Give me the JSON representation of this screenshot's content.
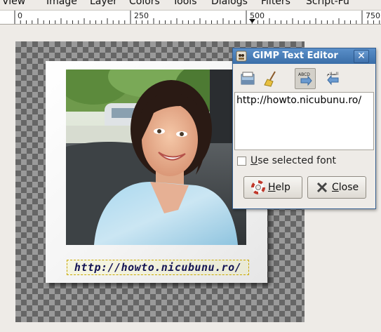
{
  "menubar": {
    "items": [
      {
        "label": "View"
      },
      {
        "label": "Image"
      },
      {
        "label": "Layer"
      },
      {
        "label": "Colors"
      },
      {
        "label": "Tools"
      },
      {
        "label": "Dialogs"
      },
      {
        "label": "Filters"
      },
      {
        "label": "Script-Fu"
      }
    ]
  },
  "ruler": {
    "labels": [
      "0",
      "250",
      "500",
      "750"
    ]
  },
  "canvas": {
    "caption_text": "http://howto.nicubunu.ro/"
  },
  "dialog": {
    "title": "GIMP Text Editor",
    "toolbar": {
      "open_icon": "open-file-icon",
      "clear_icon": "broom-icon",
      "ltr_icon_label": "ABCD",
      "rtl_icon_label": "السلام"
    },
    "text_value": "http://howto.nicubunu.ro/",
    "use_selected_font_label": "Use selected font",
    "use_selected_font_checked": false,
    "help_label": "Help",
    "close_label": "Close"
  }
}
